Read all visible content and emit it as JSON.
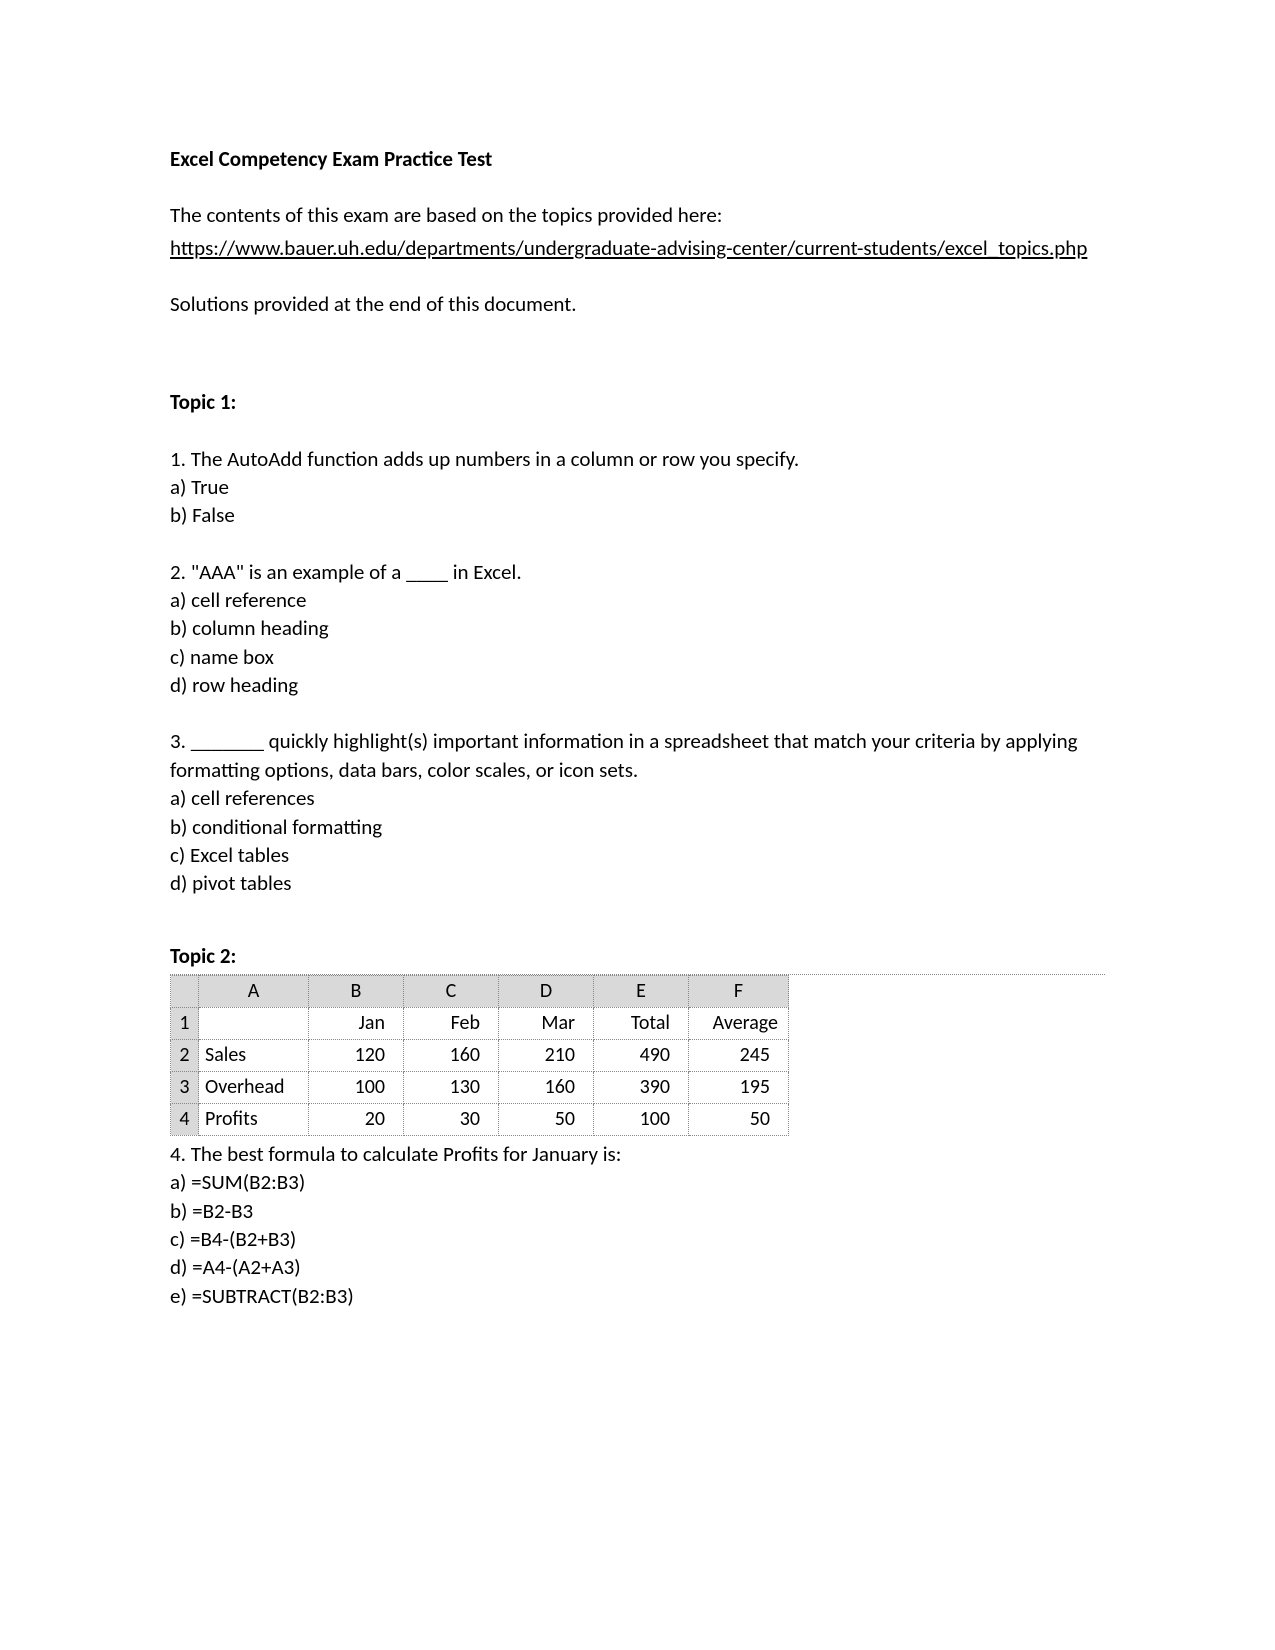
{
  "title": "Excel Competency Exam Practice Test",
  "intro": "The contents of this exam are based on the topics provided here:",
  "link": "https://www.bauer.uh.edu/departments/undergraduate-advising-center/current-students/excel_topics.php",
  "solutions_note": "Solutions provided at the end of this document.",
  "topic1": {
    "heading": "Topic 1:",
    "q1": {
      "text": "1. The AutoAdd function adds up numbers in a column or row you specify.",
      "a": "a) True",
      "b": "b) False"
    },
    "q2": {
      "text": "2. \"AAA\" is an example of a ____ in Excel.",
      "a": "a) cell reference",
      "b": "b) column heading",
      "c": "c) name box",
      "d": "d) row heading"
    },
    "q3": {
      "text": "3. _______ quickly highlight(s) important information in a spreadsheet that match your criteria by applying formatting options, data bars, color scales, or icon sets.",
      "a": "a) cell references",
      "b": "b) conditional formatting",
      "c": "c) Excel tables",
      "d": "d) pivot tables"
    }
  },
  "topic2": {
    "heading": "Topic 2:",
    "table": {
      "cols": [
        "A",
        "B",
        "C",
        "D",
        "E",
        "F"
      ],
      "rows": [
        {
          "n": "1",
          "label": "",
          "B": "Jan",
          "C": "Feb",
          "D": "Mar",
          "E": "Total",
          "F": "Average"
        },
        {
          "n": "2",
          "label": "Sales",
          "B": "120",
          "C": "160",
          "D": "210",
          "E": "490",
          "F": "245"
        },
        {
          "n": "3",
          "label": "Overhead",
          "B": "100",
          "C": "130",
          "D": "160",
          "E": "390",
          "F": "195"
        },
        {
          "n": "4",
          "label": "Profits",
          "B": "20",
          "C": "30",
          "D": "50",
          "E": "100",
          "F": "50"
        }
      ]
    },
    "q4": {
      "text": "4. The best formula to calculate Profits for January is:",
      "a": "a) =SUM(B2:B3)",
      "b": "b) =B2-B3",
      "c": "c) =B4-(B2+B3)",
      "d": "d) =A4-(A2+A3)",
      "e": "e) =SUBTRACT(B2:B3)"
    }
  }
}
